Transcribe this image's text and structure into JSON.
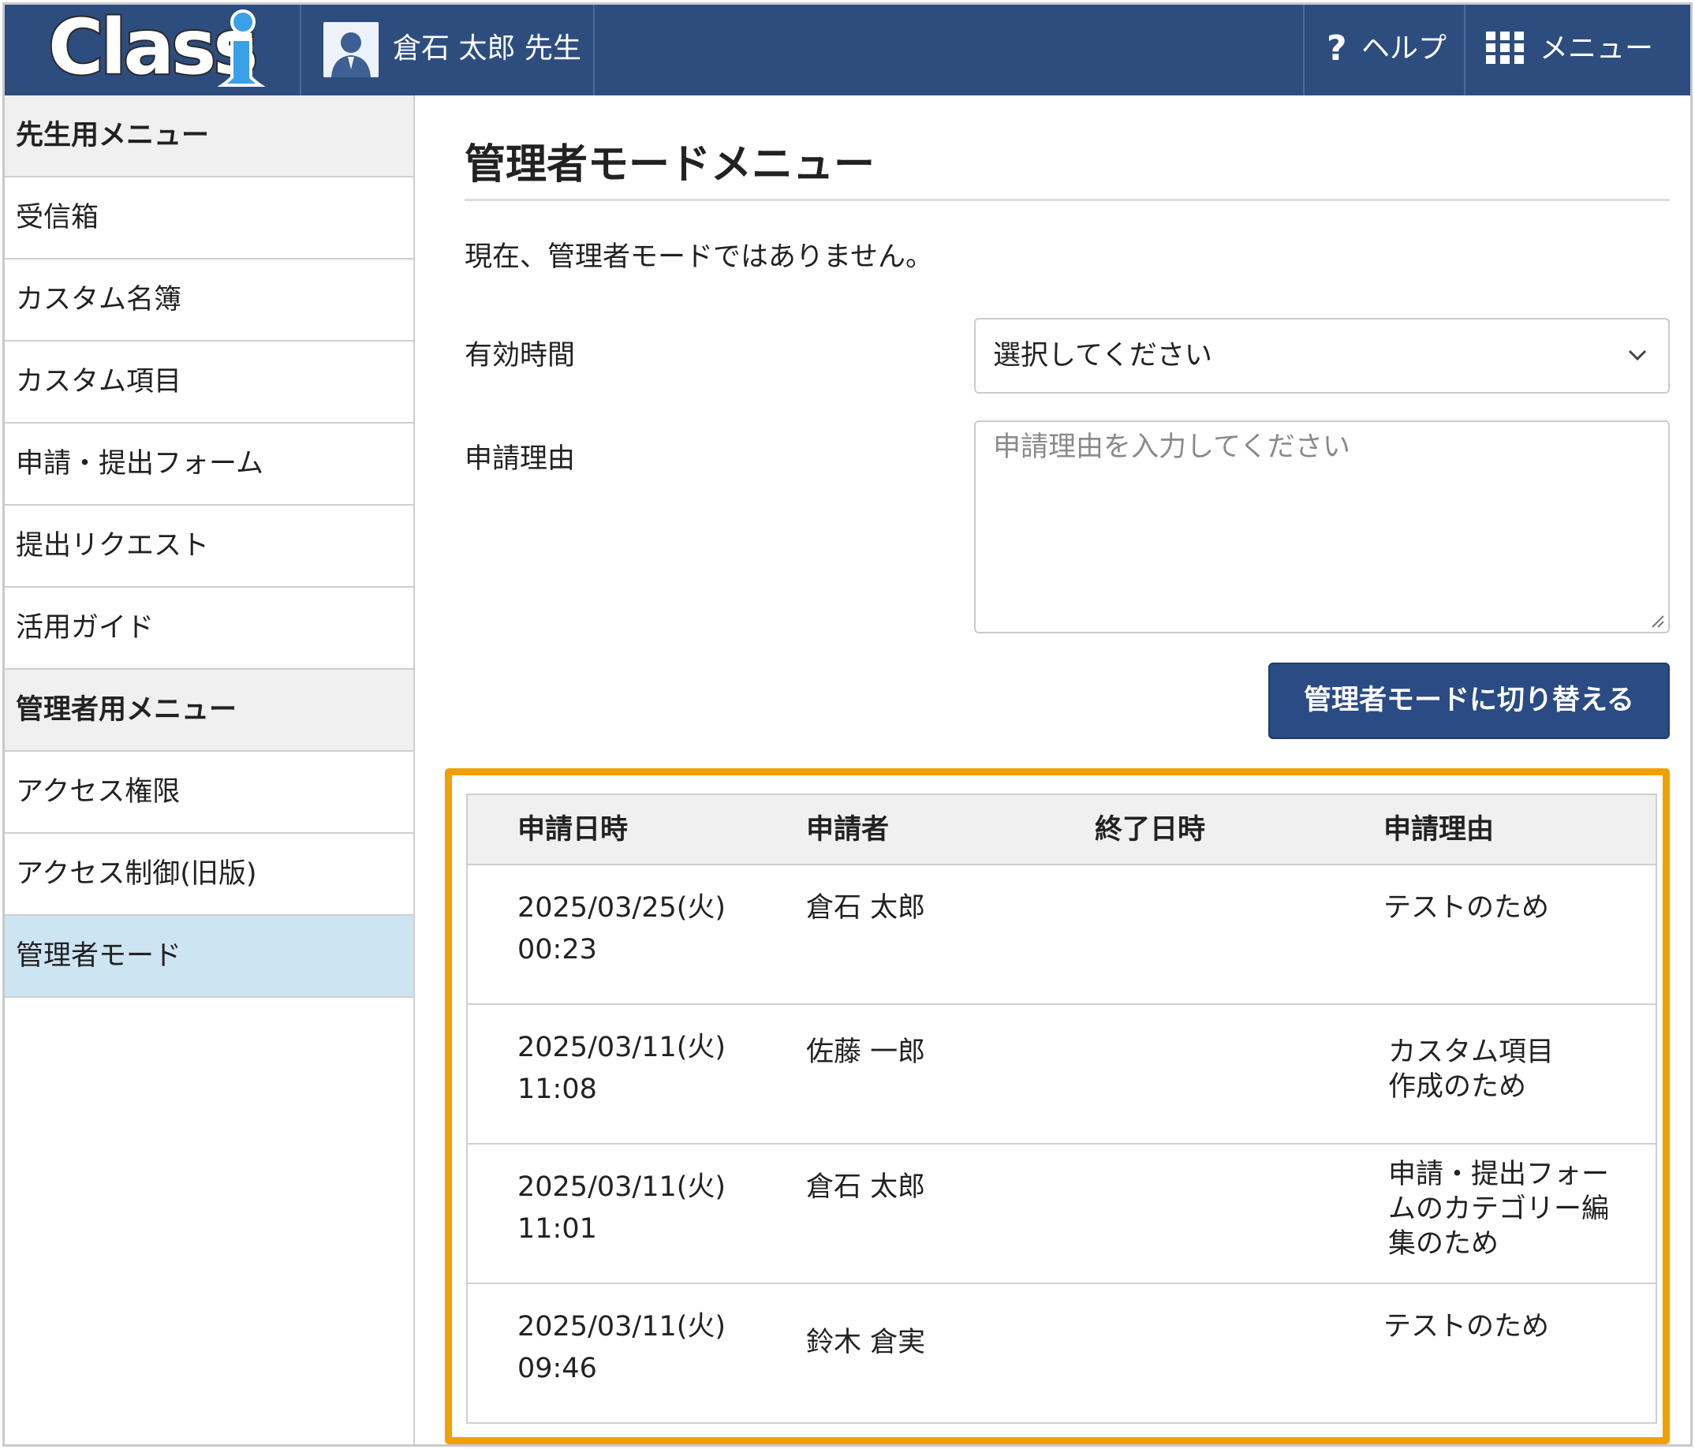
{
  "header": {
    "logo_text": "Class",
    "user_name": "倉石 太郎 先生",
    "help_label": "ヘルプ",
    "menu_label": "メニュー"
  },
  "sidebar": {
    "teacher_heading": "先生用メニュー",
    "teacher_items": [
      "受信箱",
      "カスタム名簿",
      "カスタム項目",
      "申請・提出フォーム",
      "提出リクエスト",
      "活用ガイド"
    ],
    "admin_heading": "管理者用メニュー",
    "admin_items": [
      "アクセス権限",
      "アクセス制御(旧版)",
      "管理者モード"
    ],
    "active_item": "管理者モード"
  },
  "main": {
    "title": "管理者モードメニュー",
    "status": "現在、管理者モードではありません。",
    "duration_label": "有効時間",
    "duration_value": "選択してください",
    "reason_label": "申請理由",
    "reason_placeholder": "申請理由を入力してください",
    "switch_button": "管理者モードに切り替える"
  },
  "table": {
    "columns": [
      "申請日時",
      "申請者",
      "終了日時",
      "申請理由"
    ],
    "rows": [
      {
        "date": "2025/03/25(火)",
        "time": "00:23",
        "applicant": "倉石 太郎",
        "end": "",
        "reason": [
          "テストのため"
        ]
      },
      {
        "date": "2025/03/11(火)",
        "time": "11:08",
        "applicant": "佐藤 一郎",
        "end": "",
        "reason": [
          "カスタム項目",
          "作成のため"
        ]
      },
      {
        "date": "2025/03/11(火)",
        "time": "11:01",
        "applicant": "倉石 太郎",
        "end": "",
        "reason": [
          "申請・提出フォー",
          "ムのカテゴリー編",
          "集のため"
        ]
      },
      {
        "date": "2025/03/11(火)",
        "time": "09:46",
        "applicant": "鈴木 倉実",
        "end": "",
        "reason": [
          "テストのため"
        ]
      }
    ]
  },
  "colors": {
    "header_bg": "#2d4d7e",
    "button_bg": "#2a4b84",
    "highlight_border": "#f0a000",
    "active_item_bg": "#cde4f3"
  }
}
